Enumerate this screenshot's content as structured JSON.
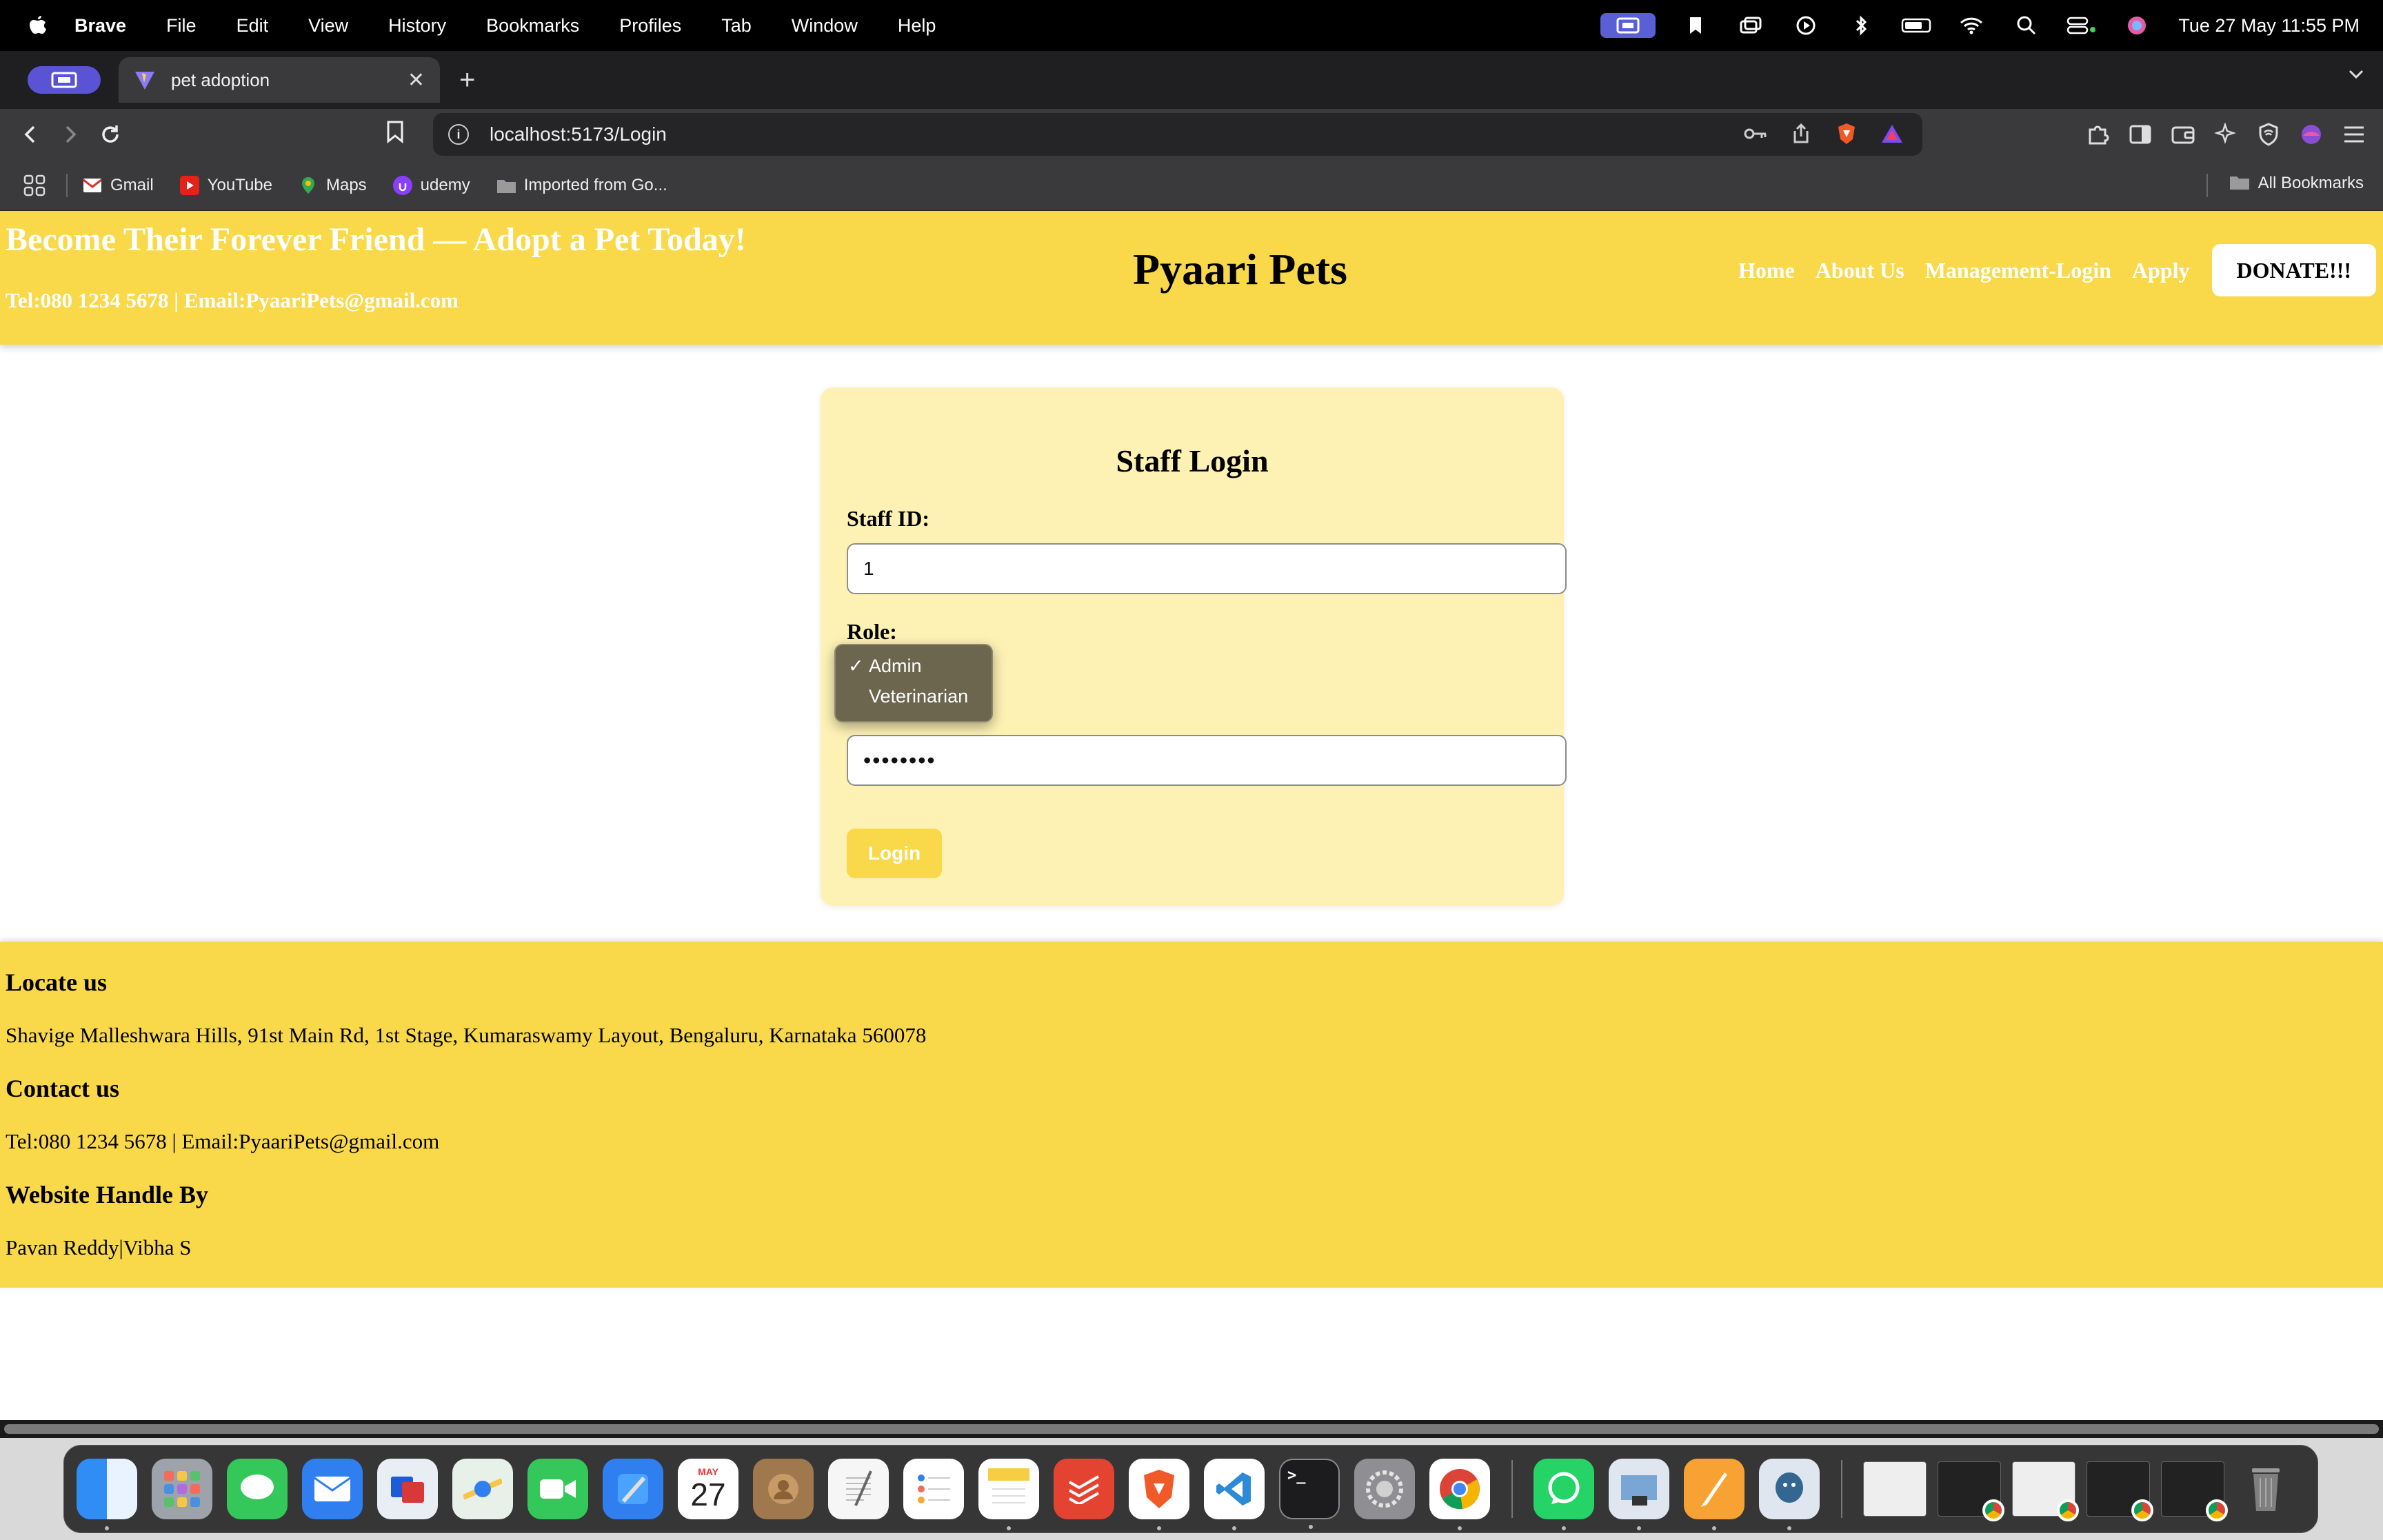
{
  "menubar": {
    "app_name": "Brave",
    "menus": [
      "File",
      "Edit",
      "View",
      "History",
      "Bookmarks",
      "Profiles",
      "Tab",
      "Window",
      "Help"
    ],
    "clock": "Tue 27 May  11:55 PM"
  },
  "browser": {
    "tab_title": "pet adoption",
    "url": "localhost:5173/Login",
    "bookmarks": [
      "Gmail",
      "YouTube",
      "Maps",
      "udemy",
      "Imported from Go..."
    ],
    "all_bookmarks": "All Bookmarks"
  },
  "header": {
    "tagline": "Become Their Forever Friend — Adopt a Pet Today!",
    "contact": "Tel:080 1234 5678 | Email:PyaariPets@gmail.com",
    "brand": "Pyaari Pets",
    "nav": [
      "Home",
      "About Us",
      "Management-Login",
      "Apply"
    ],
    "donate": "DONATE!!!"
  },
  "login": {
    "title": "Staff Login",
    "staff_id_label": "Staff ID:",
    "staff_id_value": "1",
    "role_label": "Role:",
    "role_options": [
      "Admin",
      "Veterinarian"
    ],
    "role_selected": "Admin",
    "check_mark": "✓",
    "password_value": "••••••••",
    "login_button": "Login"
  },
  "footer": {
    "locate_heading": "Locate us",
    "address": "Shavige Malleshwara Hills, 91st Main Rd, 1st Stage, Kumaraswamy Layout, Bengaluru, Karnataka 560078",
    "contact_heading": "Contact us",
    "contact": "Tel:080 1234 5678 | Email:PyaariPets@gmail.com",
    "handle_heading": "Website Handle By",
    "handle": "Pavan Reddy|Vibha S"
  },
  "dock": {
    "calendar_month": "MAY",
    "calendar_day": "27"
  },
  "colors": {
    "brand_yellow": "#f9d84a",
    "card_bg": "#fdf1b4",
    "profile_purple": "#5b53d6"
  }
}
